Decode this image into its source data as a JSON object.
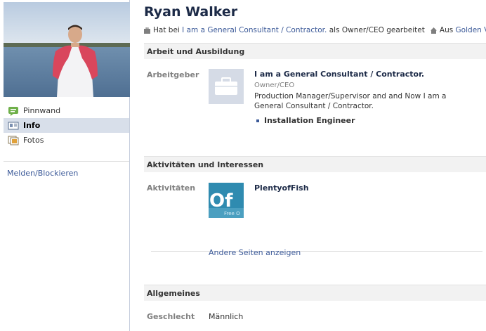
{
  "profile": {
    "name": "Ryan Walker",
    "byline": {
      "prefix": "Hat bei",
      "employer_link": "I am a General Consultant / Contractor.",
      "role_text": "als Owner/CEO gearbeitet",
      "from_prefix": "Aus",
      "location_link": "Golden Valley"
    }
  },
  "nav": {
    "items": [
      {
        "label": "Pinnwand",
        "icon": "wall-icon",
        "active": false
      },
      {
        "label": "Info",
        "icon": "info-icon",
        "active": true
      },
      {
        "label": "Fotos",
        "icon": "photos-icon",
        "active": false
      }
    ],
    "report_link": "Melden/Blockieren"
  },
  "sections": {
    "work": {
      "header": "Arbeit und Ausbildung",
      "label": "Arbeitgeber",
      "employer": "I am a General Consultant / Contractor.",
      "role": "Owner/CEO",
      "description": "Production Manager/Supervisor and and Now I am a General Consultant / Contractor.",
      "project": "Installation Engineer"
    },
    "activities": {
      "header": "Aktivitäten und Interessen",
      "label": "Aktivitäten",
      "page_name": "PlentyofFish",
      "thumb_text": "Of",
      "thumb_subtext": "Free O",
      "more_link": "Andere Seiten anzeigen"
    },
    "general": {
      "header": "Allgemeines",
      "gender_label": "Geschlecht",
      "gender_value": "Männlich"
    }
  },
  "colors": {
    "link": "#3b5998",
    "active_nav_bg": "#d8dfea",
    "name": "#1c2a47"
  }
}
